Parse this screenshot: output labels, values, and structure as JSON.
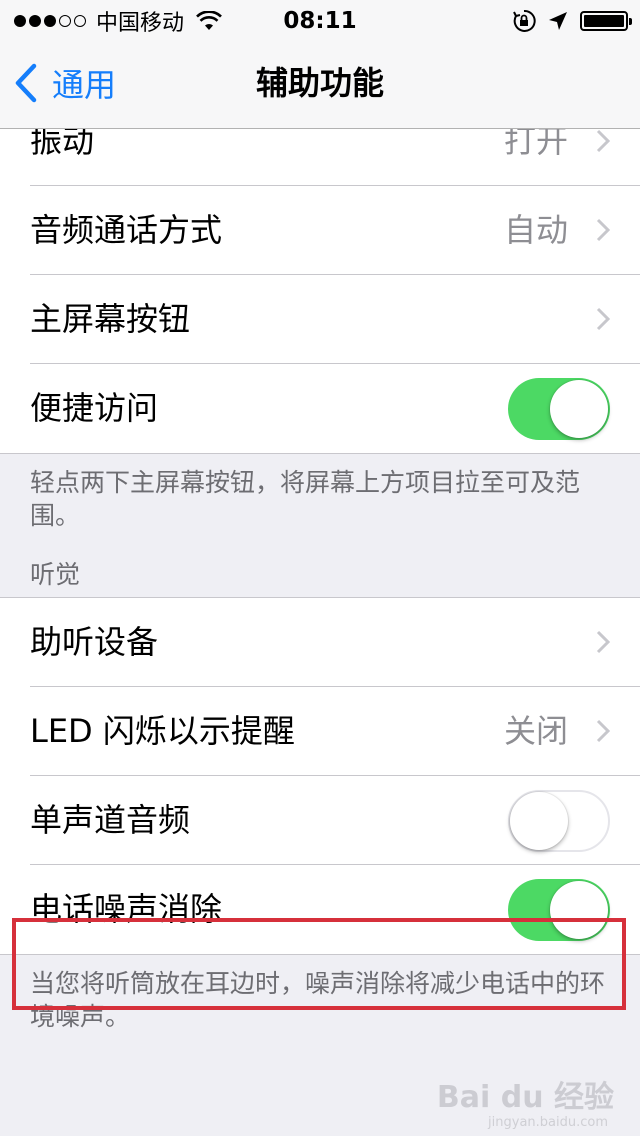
{
  "status_bar": {
    "carrier": "中国移动",
    "time": "08:11"
  },
  "nav": {
    "back_label": "通用",
    "title": "辅助功能"
  },
  "section1": {
    "rows": [
      {
        "label": "振动",
        "value": "打开"
      },
      {
        "label": "音频通话方式",
        "value": "自动"
      },
      {
        "label": "主屏幕按钮"
      },
      {
        "label": "便捷访问",
        "toggle": true
      }
    ],
    "footer": "轻点两下主屏幕按钮，将屏幕上方项目拉至可及范围。"
  },
  "section2": {
    "header": "听觉",
    "rows": [
      {
        "label": "助听设备"
      },
      {
        "label": "LED 闪烁以示提醒",
        "value": "关闭"
      },
      {
        "label": "单声道音频",
        "toggle": false
      },
      {
        "label": "电话噪声消除",
        "toggle": true
      }
    ],
    "footer": "当您将听筒放在耳边时，噪声消除将减少电话中的环境噪声。"
  },
  "colors": {
    "accent": "#157efb",
    "toggle_on": "#4cd964",
    "highlight": "#d6303b"
  },
  "watermark": {
    "text": "Bai du 经验",
    "sub": "jingyan.baidu.com"
  }
}
